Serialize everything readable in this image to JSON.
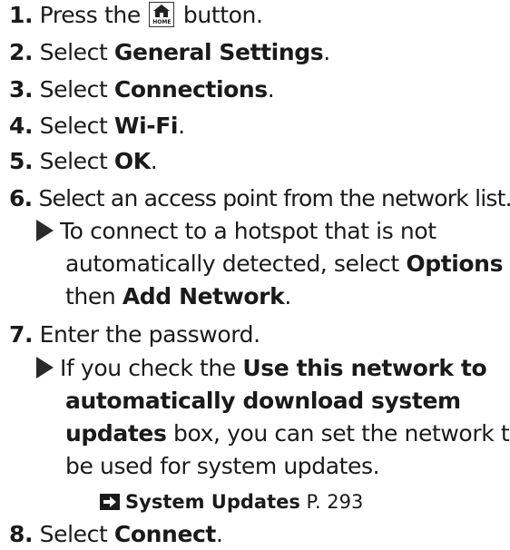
{
  "steps": [
    {
      "num": "1.",
      "pre": "Press the",
      "icon": "home-icon",
      "icon_text": "HOME",
      "post": "button."
    },
    {
      "num": "2.",
      "pre": "Select",
      "bold": "General Settings",
      "post": "."
    },
    {
      "num": "3.",
      "pre": "Select",
      "bold": "Connections",
      "post": "."
    },
    {
      "num": "4.",
      "pre": "Select",
      "bold": "Wi-Fi",
      "post": "."
    },
    {
      "num": "5.",
      "pre": "Select",
      "bold": "OK",
      "post": "."
    },
    {
      "num": "6.",
      "text": "Select an access point from the network list."
    },
    {
      "num": "7.",
      "text": "Enter the password."
    },
    {
      "num": "8.",
      "pre": "Select",
      "bold": "Connect",
      "post": "."
    }
  ],
  "note6": {
    "line1": "To connect to a hotspot that is not",
    "line2_pre": "automatically detected, select",
    "line2_bold": "Options",
    "line3_bold_after": "Add Network",
    "line3_pre": "then",
    "line3_post": "."
  },
  "note7": {
    "line1_pre": "If you check the",
    "line1_bold": "Use this network to",
    "line2_bold": "automatically download system",
    "line3_bold": "updates",
    "line3_post": "box, you can set the network to",
    "line4": "be used for system updates."
  },
  "reference": {
    "icon": "cross-reference-arrow-icon",
    "label": "System Updates",
    "page": "P. 293"
  }
}
